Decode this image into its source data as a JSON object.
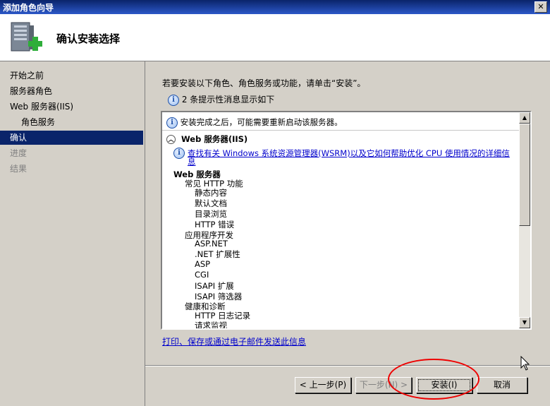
{
  "window": {
    "title": "添加角色向导",
    "close_glyph": "✕"
  },
  "header": {
    "heading": "确认安装选择",
    "icon": "server-add-icon"
  },
  "nav": {
    "items": [
      {
        "label": "开始之前",
        "state": "normal",
        "level": 0
      },
      {
        "label": "服务器角色",
        "state": "normal",
        "level": 0
      },
      {
        "label": "Web 服务器(IIS)",
        "state": "normal",
        "level": 0
      },
      {
        "label": "角色服务",
        "state": "normal",
        "level": 1
      },
      {
        "label": "确认",
        "state": "active",
        "level": 0
      },
      {
        "label": "进度",
        "state": "dim",
        "level": 0
      },
      {
        "label": "结果",
        "state": "dim",
        "level": 0
      }
    ]
  },
  "main": {
    "intro": "若要安装以下角色、角色服务或功能，请单击“安装”。",
    "info_count": "2 条提示性消息显示如下",
    "list": {
      "restart_notice": "安装完成之后，可能需要重新启动该服务器。",
      "section_title": "Web 服务器(IIS)",
      "wsrm_link": "查找有关 Windows 系统资源管理器(WSRM)以及它如何帮助优化 CPU 使用情况的详细信",
      "wsrm_link_cont": "息",
      "items": [
        {
          "label": "Web 服务器",
          "level": 0
        },
        {
          "label": "常见 HTTP 功能",
          "level": 1
        },
        {
          "label": "静态内容",
          "level": 2
        },
        {
          "label": "默认文档",
          "level": 2
        },
        {
          "label": "目录浏览",
          "level": 2
        },
        {
          "label": "HTTP 错误",
          "level": 2
        },
        {
          "label": "应用程序开发",
          "level": 1
        },
        {
          "label": "ASP.NET",
          "level": 2
        },
        {
          "label": ".NET 扩展性",
          "level": 2
        },
        {
          "label": "ASP",
          "level": 2
        },
        {
          "label": "CGI",
          "level": 2
        },
        {
          "label": "ISAPI 扩展",
          "level": 2
        },
        {
          "label": "ISAPI 筛选器",
          "level": 2
        },
        {
          "label": "健康和诊断",
          "level": 1
        },
        {
          "label": "HTTP 日志记录",
          "level": 2
        },
        {
          "label": "请求监视",
          "level": 2
        }
      ]
    },
    "print_link": "打印、保存或通过电子邮件发送此信息"
  },
  "buttons": {
    "prev": "< 上一步(P)",
    "next": "下一步(N) >",
    "install": "安装(I)",
    "cancel": "取消"
  },
  "colors": {
    "active_nav": "#0a246a",
    "link": "#0000cc",
    "annotation": "#e00000"
  }
}
